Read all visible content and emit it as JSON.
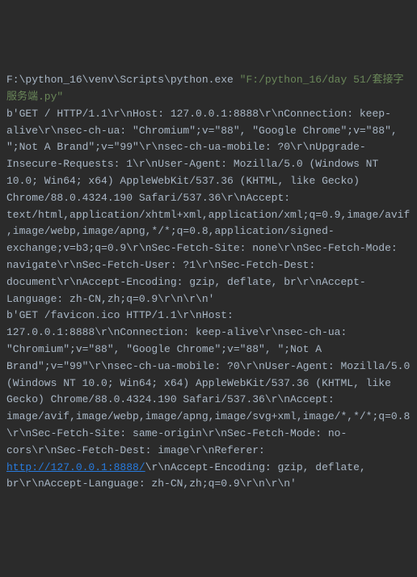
{
  "command": {
    "interpreter": "F:\\python_16\\venv\\Scripts\\python.exe ",
    "script": "\"F:/python_16/day 51/套接字服务端.py\""
  },
  "output": {
    "block1": "b'GET / HTTP/1.1\\r\\nHost: 127.0.0.1:8888\\r\\nConnection: keep-alive\\r\\nsec-ch-ua: \"Chromium\";v=\"88\", \"Google Chrome\";v=\"88\", \";Not A Brand\";v=\"99\"\\r\\nsec-ch-ua-mobile: ?0\\r\\nUpgrade-Insecure-Requests: 1\\r\\nUser-Agent: Mozilla/5.0 (Windows NT 10.0; Win64; x64) AppleWebKit/537.36 (KHTML, like Gecko) Chrome/88.0.4324.190 Safari/537.36\\r\\nAccept: text/html,application/xhtml+xml,application/xml;q=0.9,image/avif,image/webp,image/apng,*/*;q=0.8,application/signed-exchange;v=b3;q=0.9\\r\\nSec-Fetch-Site: none\\r\\nSec-Fetch-Mode: navigate\\r\\nSec-Fetch-User: ?1\\r\\nSec-Fetch-Dest: document\\r\\nAccept-Encoding: gzip, deflate, br\\r\\nAccept-Language: zh-CN,zh;q=0.9\\r\\n\\r\\n'",
    "block2_prefix": "b'GET /favicon.ico HTTP/1.1\\r\\nHost: 127.0.0.1:8888\\r\\nConnection: keep-alive\\r\\nsec-ch-ua: \"Chromium\";v=\"88\", \"Google Chrome\";v=\"88\", \";Not A Brand\";v=\"99\"\\r\\nsec-ch-ua-mobile: ?0\\r\\nUser-Agent: Mozilla/5.0 (Windows NT 10.0; Win64; x64) AppleWebKit/537.36 (KHTML, like Gecko) Chrome/88.0.4324.190 Safari/537.36\\r\\nAccept: image/avif,image/webp,image/apng,image/svg+xml,image/*,*/*;q=0.8\\r\\nSec-Fetch-Site: same-origin\\r\\nSec-Fetch-Mode: no-cors\\r\\nSec-Fetch-Dest: image\\r\\nReferer: ",
    "url": "http://127.0.0.1:8888/",
    "block2_suffix": "\\r\\nAccept-Encoding: gzip, deflate, br\\r\\nAccept-Language: zh-CN,zh;q=0.9\\r\\n\\r\\n'"
  }
}
